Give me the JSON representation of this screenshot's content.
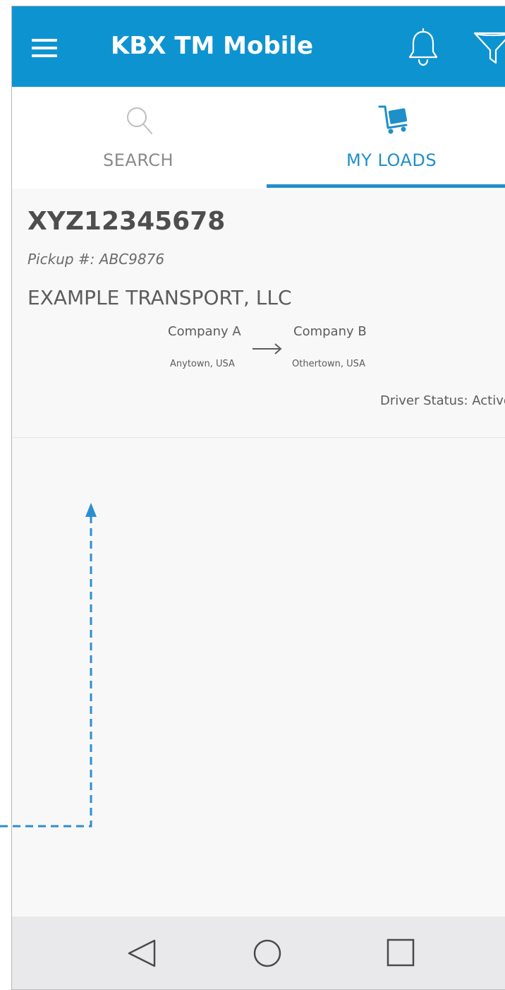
{
  "app": {
    "title": "KBX TM Mobile",
    "accent_color": "#0e93d1",
    "icons": [
      "menu-icon",
      "bell-icon",
      "filter-icon"
    ]
  },
  "tabs": [
    {
      "label": "SEARCH",
      "icon": "search-icon",
      "active": false
    },
    {
      "label": "MY LOADS",
      "icon": "cart-icon",
      "active": true
    }
  ],
  "load": {
    "id": "XYZ12345678",
    "pickup": "Pickup #: ABC9876",
    "carrier": "EXAMPLE TRANSPORT, LLC",
    "origin": {
      "name": "Company A",
      "city": "Anytown, USA"
    },
    "destination": {
      "name": "Company B",
      "city": "Othertown, USA"
    },
    "driver_status": "Driver Status: Active"
  },
  "navbar": {
    "buttons": [
      "back-icon",
      "home-icon",
      "recents-icon"
    ]
  }
}
